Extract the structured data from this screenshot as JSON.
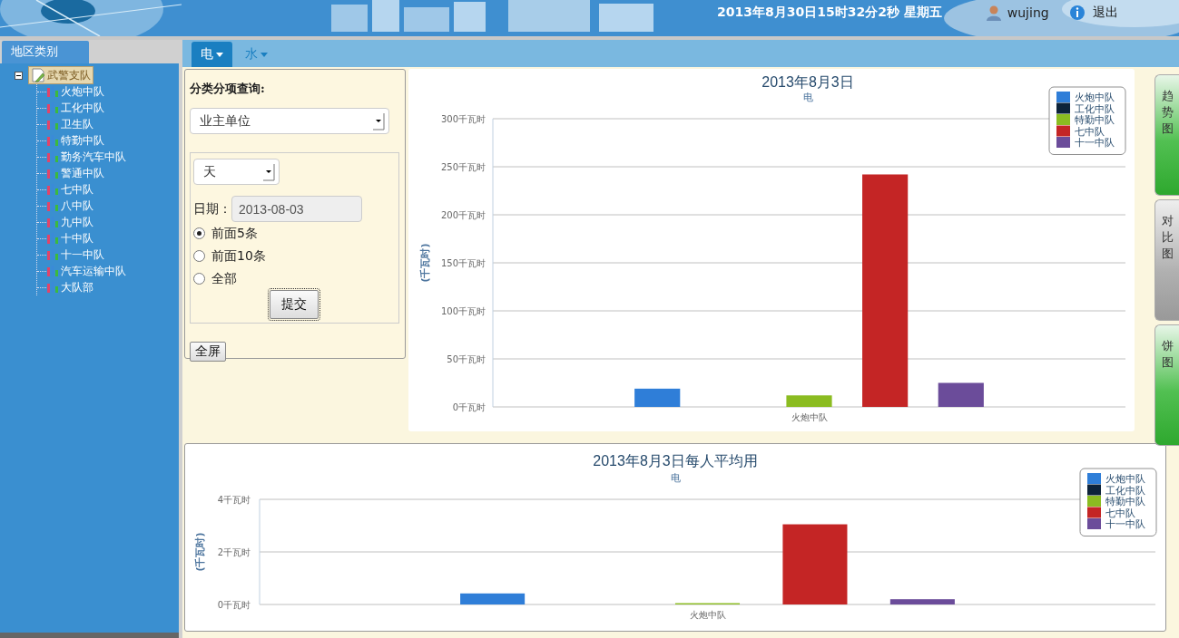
{
  "header": {
    "datetime": "2013年8月30日15时32分2秒 星期五",
    "user": "wujing",
    "logout": "退出"
  },
  "sidebar": {
    "title": "地区类别",
    "tree": [
      {
        "label": "武警支队",
        "expanded": true,
        "selected": true,
        "children": [
          {
            "label": "火炮中队"
          },
          {
            "label": "工化中队"
          },
          {
            "label": "卫生队"
          },
          {
            "label": "特勤中队"
          },
          {
            "label": "勤务汽车中队"
          },
          {
            "label": "警通中队"
          },
          {
            "label": "七中队"
          },
          {
            "label": "八中队"
          },
          {
            "label": "九中队"
          },
          {
            "label": "十中队"
          },
          {
            "label": "十一中队"
          },
          {
            "label": "汽车运输中队"
          },
          {
            "label": "大队部"
          }
        ]
      }
    ]
  },
  "tabs": [
    {
      "label": "电",
      "selected": true
    },
    {
      "label": "水",
      "selected": false
    }
  ],
  "filter": {
    "title": "分类分项查询:",
    "category": "业主单位",
    "period": "天",
    "date_label": "日期：",
    "date": "2013-08-03",
    "options": [
      {
        "label": "前面5条",
        "selected": true
      },
      {
        "label": "前面10条",
        "selected": false
      },
      {
        "label": "全部",
        "selected": false
      }
    ],
    "submit": "提交",
    "fullscreen": "全屏"
  },
  "side_tabs": [
    {
      "label": "趋势图",
      "selected": false
    },
    {
      "label": "对比图",
      "selected": true
    },
    {
      "label": "饼图",
      "selected": false
    }
  ],
  "charts": [
    {
      "subtitle": "电",
      "chart_data": {
        "type": "bar",
        "title": "2013年8月3日",
        "ylabel": "(千瓦时)",
        "categories": [
          "火炮中队"
        ],
        "series": [
          {
            "name": "火炮中队",
            "color": "#2f7ed8",
            "values": [
              19
            ]
          },
          {
            "name": "工化中队",
            "color": "#0d233a",
            "values": [
              0
            ]
          },
          {
            "name": "特勤中队",
            "color": "#8bbc21",
            "values": [
              12
            ]
          },
          {
            "name": "七中队",
            "color": "#c42525",
            "values": [
              242
            ]
          },
          {
            "name": "十一中队",
            "color": "#6b4c9a",
            "values": [
              25
            ]
          }
        ],
        "grid": true,
        "legend": true,
        "ylim": [
          0,
          300
        ],
        "yticks": [
          {
            "value": 0,
            "label": "0千瓦时"
          },
          {
            "value": 50,
            "label": "50千瓦时"
          },
          {
            "value": 100,
            "label": "100千瓦时"
          },
          {
            "value": 150,
            "label": "150千瓦时"
          },
          {
            "value": 200,
            "label": "200千瓦时"
          },
          {
            "value": 250,
            "label": "250千瓦时"
          },
          {
            "value": 300,
            "label": "300千瓦时"
          }
        ]
      }
    },
    {
      "subtitle": "电",
      "chart_data": {
        "type": "bar",
        "title": "2013年8月3日每人平均用",
        "ylabel": "(千瓦时)",
        "categories": [
          "火炮中队"
        ],
        "series": [
          {
            "name": "火炮中队",
            "color": "#2f7ed8",
            "values": [
              0.42
            ]
          },
          {
            "name": "工化中队",
            "color": "#0d233a",
            "values": [
              0
            ]
          },
          {
            "name": "特勤中队",
            "color": "#8bbc21",
            "values": [
              0.05
            ]
          },
          {
            "name": "七中队",
            "color": "#c42525",
            "values": [
              3.05
            ]
          },
          {
            "name": "十一中队",
            "color": "#6b4c9a",
            "values": [
              0.2
            ]
          }
        ],
        "grid": true,
        "legend": true,
        "ylim": [
          0,
          4
        ],
        "yticks": [
          {
            "value": 0,
            "label": "0千瓦时"
          },
          {
            "value": 2,
            "label": "2千瓦时"
          },
          {
            "value": 4,
            "label": "4千瓦时"
          }
        ]
      }
    }
  ]
}
